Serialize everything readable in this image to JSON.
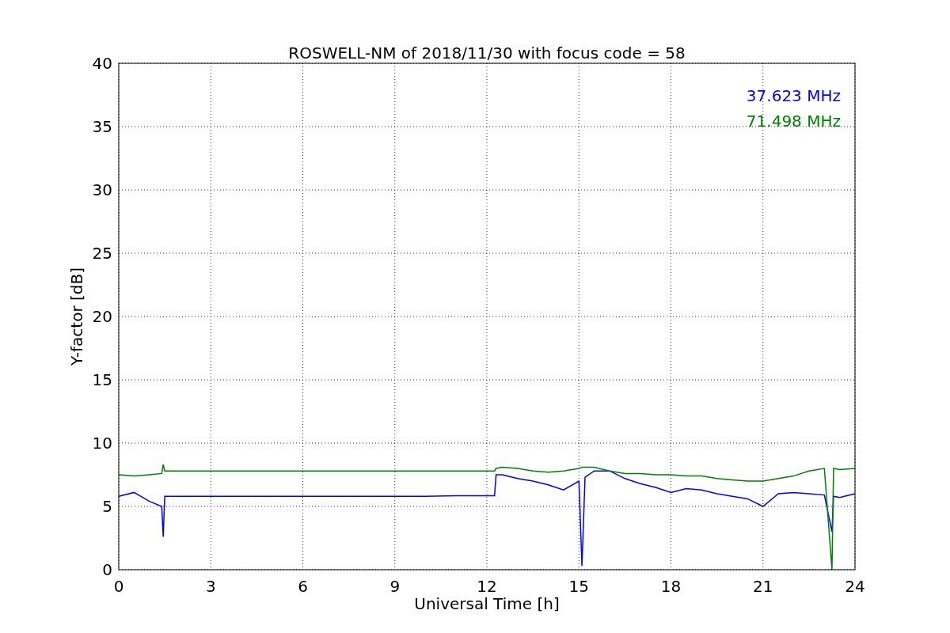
{
  "chart_data": {
    "type": "line",
    "grid": true,
    "title": "ROSWELL-NM of 2018/11/30 with focus code = 58",
    "xlabel": "Universal Time [h]",
    "ylabel": "Y-factor [dB]",
    "xlim": [
      0,
      24
    ],
    "ylim": [
      0,
      40
    ],
    "xticks": [
      0,
      3,
      6,
      9,
      12,
      15,
      18,
      21,
      24
    ],
    "yticks": [
      0,
      5,
      10,
      15,
      20,
      25,
      30,
      35,
      40
    ],
    "x": [
      0,
      0.5,
      1,
      1.4,
      1.45,
      1.5,
      2,
      3,
      4,
      5,
      6,
      7,
      8,
      9,
      10,
      11,
      12,
      12.25,
      12.3,
      12.5,
      13,
      13.5,
      14,
      14.5,
      15,
      15.1,
      15.2,
      15.5,
      16,
      16.5,
      17,
      17.5,
      18,
      18.5,
      19,
      19.5,
      20,
      20.5,
      21,
      21.5,
      22,
      22.5,
      23,
      23.25,
      23.3,
      23.5,
      24
    ],
    "series": [
      {
        "name": "37.623 MHz",
        "color": "#0000ff",
        "values": [
          5.8,
          6.1,
          5.4,
          5.0,
          2.6,
          5.8,
          5.8,
          5.8,
          5.8,
          5.8,
          5.8,
          5.8,
          5.8,
          5.8,
          5.8,
          5.85,
          5.85,
          5.85,
          7.5,
          7.5,
          7.2,
          7.0,
          6.7,
          6.3,
          7.0,
          0.3,
          7.3,
          7.8,
          7.8,
          7.2,
          6.8,
          6.5,
          6.1,
          6.4,
          6.3,
          6.0,
          5.8,
          5.6,
          5.0,
          6.0,
          6.1,
          6.0,
          5.9,
          3.0,
          5.8,
          5.7,
          6.0
        ]
      },
      {
        "name": "71.498 MHz",
        "color": "#008000",
        "values": [
          7.5,
          7.4,
          7.5,
          7.6,
          8.3,
          7.8,
          7.8,
          7.8,
          7.8,
          7.8,
          7.8,
          7.8,
          7.8,
          7.8,
          7.8,
          7.8,
          7.8,
          7.8,
          8.0,
          8.1,
          8.0,
          7.8,
          7.7,
          7.8,
          8.0,
          8.1,
          8.1,
          8.1,
          7.8,
          7.6,
          7.6,
          7.5,
          7.5,
          7.4,
          7.4,
          7.2,
          7.1,
          7.0,
          7.0,
          7.2,
          7.4,
          7.8,
          8.0,
          0.0,
          8.0,
          7.9,
          8.0
        ]
      }
    ]
  }
}
